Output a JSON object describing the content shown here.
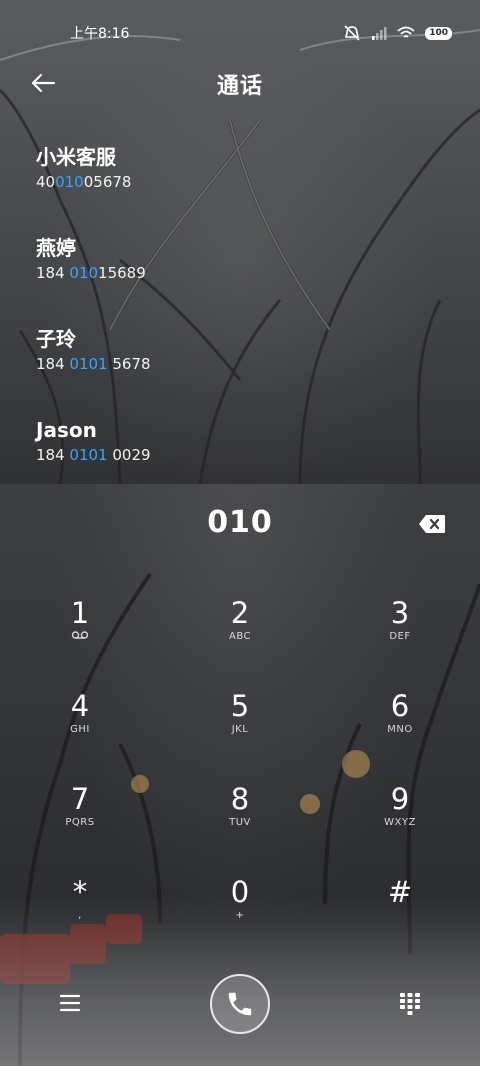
{
  "status_bar": {
    "time": "上午8:16",
    "battery": "100"
  },
  "header": {
    "title": "通话"
  },
  "contacts": [
    {
      "name": "小米客服",
      "num_pre": "40",
      "num_hl": "010",
      "num_post": "05678"
    },
    {
      "name": "燕婷",
      "num_pre": "184 ",
      "num_hl": "010",
      "num_post": "15689"
    },
    {
      "name": "子玲",
      "num_pre": "184 ",
      "num_hl": "0101",
      "num_post": " 5678"
    },
    {
      "name": "Jason",
      "num_pre": "184 ",
      "num_hl": "0101",
      "num_post": " 0029"
    }
  ],
  "dial": {
    "number": "010"
  },
  "keypad": {
    "keys": [
      {
        "digit": "1",
        "sub": ""
      },
      {
        "digit": "2",
        "sub": "ABC"
      },
      {
        "digit": "3",
        "sub": "DEF"
      },
      {
        "digit": "4",
        "sub": "GHI"
      },
      {
        "digit": "5",
        "sub": "JKL"
      },
      {
        "digit": "6",
        "sub": "MNO"
      },
      {
        "digit": "7",
        "sub": "PQRS"
      },
      {
        "digit": "8",
        "sub": "TUV"
      },
      {
        "digit": "9",
        "sub": "WXYZ"
      },
      {
        "digit": "*",
        "sub": ","
      },
      {
        "digit": "0",
        "sub": "+"
      },
      {
        "digit": "#",
        "sub": ""
      }
    ]
  },
  "icons": {
    "back": "back-arrow-icon",
    "backspace": "backspace-icon",
    "voicemail": "voicemail-icon",
    "menu": "menu-icon",
    "call": "phone-icon",
    "keypad_toggle": "dialpad-icon"
  },
  "colors": {
    "highlight": "#3aa2ff"
  }
}
